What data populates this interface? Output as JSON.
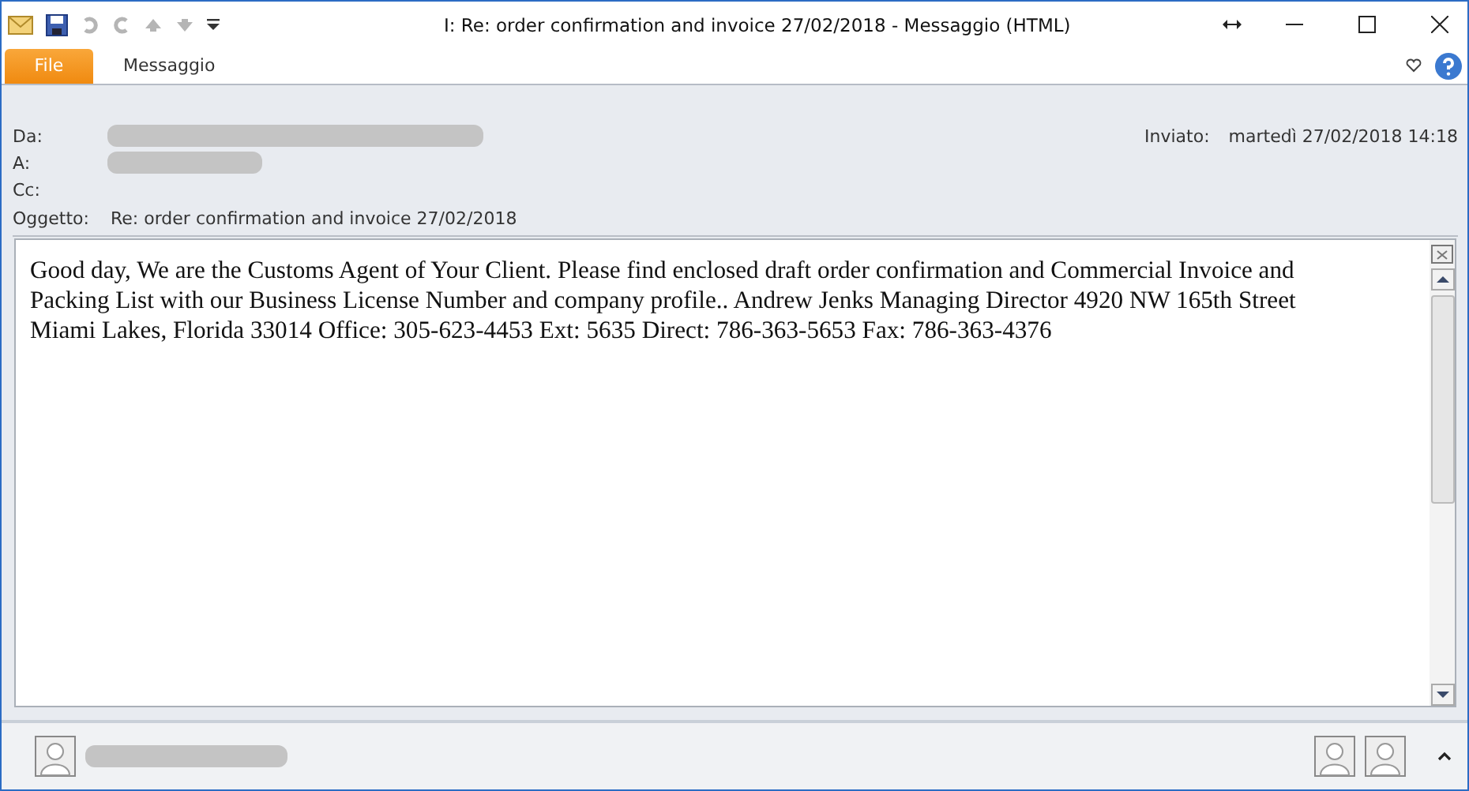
{
  "window": {
    "title": "I: Re: order confirmation and invoice 27/02/2018  -  Messaggio (HTML)"
  },
  "tabs": [
    {
      "label": "File",
      "selected": true
    },
    {
      "label": "Messaggio",
      "selected": false
    }
  ],
  "header": {
    "fields": [
      {
        "label": "Da:",
        "redacted": true
      },
      {
        "label": "A:",
        "redacted": true
      },
      {
        "label": "Cc:",
        "redacted": false
      }
    ],
    "sent_label": "Inviato:",
    "sent_value": "martedì 27/02/2018 14:18",
    "subject_label": "Oggetto:",
    "subject": "Re: order confirmation and invoice 27/02/2018"
  },
  "body": "Good day, We are the Customs Agent of Your Client. Please find enclosed draft order confirmation and Commercial Invoice and Packing List with our Business License Number and company profile.. Andrew Jenks Managing Director 4920 NW 165th Street Miami Lakes, Florida 33014 Office: 305-623-4453 Ext: 5635 Direct: 786-363-5653 Fax: 786-363-4376"
}
